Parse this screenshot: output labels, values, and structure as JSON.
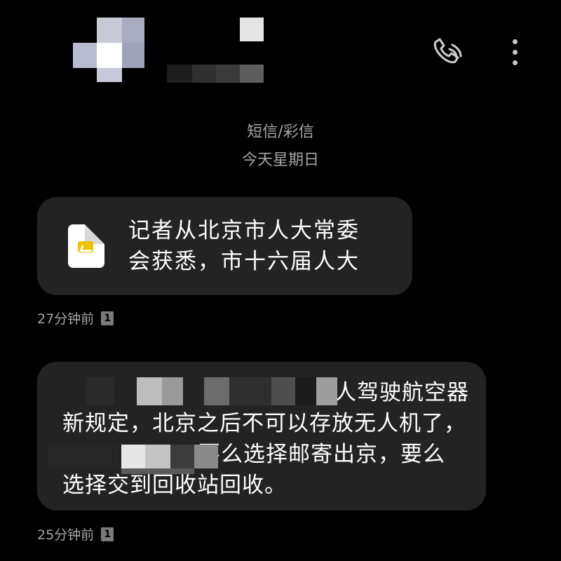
{
  "thread": {
    "type_label": "短信/彩信",
    "date_label": "今天星期日"
  },
  "icons": {
    "call": "phone-icon",
    "more": "more-vert-icon",
    "attachment": "image-file-icon",
    "sim": "sim-1-icon"
  },
  "messages": [
    {
      "lines": [
        "记者从北京市人大常委",
        "会获悉，市十六届人大"
      ],
      "time": "27分钟前",
      "sim": "1"
    },
    {
      "lines": [
        "人驾驶航空器",
        "新规定，北京之后不可以存放无人机了，",
        "要么选择邮寄出京，要么",
        "选择交到回收站回收。"
      ],
      "time": "25分钟前",
      "sim": "1"
    }
  ],
  "colors": {
    "background": "#000000",
    "bubble": "#232323",
    "meta_text": "#a6a6a6",
    "accent_yellow": "#f2c200"
  }
}
